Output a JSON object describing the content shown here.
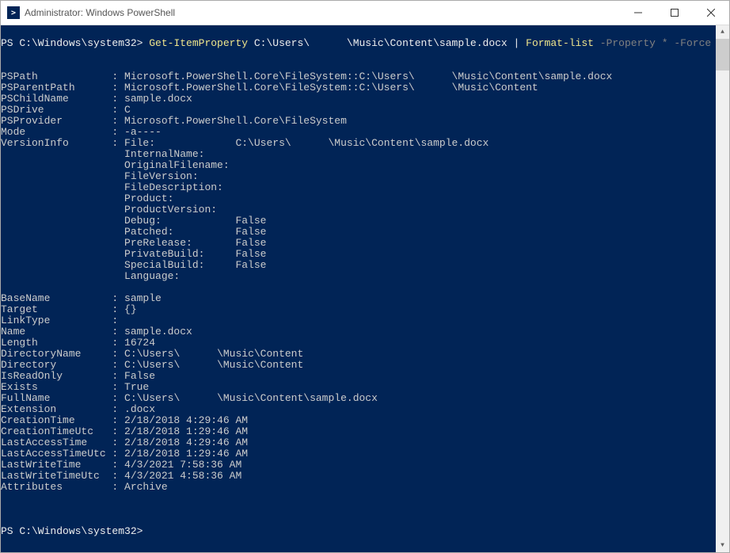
{
  "window": {
    "title": "Administrator: Windows PowerShell"
  },
  "console": {
    "prompt1": "PS C:\\Windows\\system32> ",
    "cmd_part1": "Get-ItemProperty ",
    "cmd_path_a": "C:\\Users\\",
    "cmd_path_redacted": "      ",
    "cmd_path_b": "\\Music\\Content\\sample.docx ",
    "cmd_pipe": "| ",
    "cmd_part2": "Format-list ",
    "cmd_args": "-Property * -Force",
    "blank": "",
    "props": {
      "PSPath_label": "PSPath            : ",
      "PSPath_a": "Microsoft.PowerShell.Core\\FileSystem::C:\\Users\\",
      "PSPath_b": "\\Music\\Content\\sample.docx",
      "PSParentPath_label": "PSParentPath      : ",
      "PSParentPath_a": "Microsoft.PowerShell.Core\\FileSystem::C:\\Users\\",
      "PSParentPath_b": "\\Music\\Content",
      "PSChildName": "PSChildName       : sample.docx",
      "PSDrive": "PSDrive           : C",
      "PSProvider": "PSProvider        : Microsoft.PowerShell.Core\\FileSystem",
      "Mode": "Mode              : -a----",
      "VersionInfo_label": "VersionInfo       : ",
      "Version_File_a": "File:             C:\\Users\\",
      "Version_File_b": "\\Music\\Content\\sample.docx",
      "Version_InternalName": "                    InternalName:     ",
      "Version_OriginalFilename": "                    OriginalFilename: ",
      "Version_FileVersion": "                    FileVersion:      ",
      "Version_FileDescription": "                    FileDescription:  ",
      "Version_Product": "                    Product:          ",
      "Version_ProductVersion": "                    ProductVersion:   ",
      "Version_Debug": "                    Debug:            False",
      "Version_Patched": "                    Patched:          False",
      "Version_PreRelease": "                    PreRelease:       False",
      "Version_PrivateBuild": "                    PrivateBuild:     False",
      "Version_SpecialBuild": "                    SpecialBuild:     False",
      "Version_Language": "                    Language:         ",
      "BaseName": "BaseName          : sample",
      "Target": "Target            : {}",
      "LinkType": "LinkType          : ",
      "Name": "Name              : sample.docx",
      "Length": "Length            : 16724",
      "DirectoryName_label": "DirectoryName     : ",
      "DirectoryName_a": "C:\\Users\\",
      "DirectoryName_b": "\\Music\\Content",
      "Directory_label": "Directory         : ",
      "Directory_a": "C:\\Users\\",
      "Directory_b": "\\Music\\Content",
      "IsReadOnly": "IsReadOnly        : False",
      "Exists": "Exists            : True",
      "FullName_label": "FullName          : ",
      "FullName_a": "C:\\Users\\",
      "FullName_b": "\\Music\\Content\\sample.docx",
      "Extension": "Extension         : .docx",
      "CreationTime": "CreationTime      : 2/18/2018 4:29:46 AM",
      "CreationTimeUtc": "CreationTimeUtc   : 2/18/2018 1:29:46 AM",
      "LastAccessTime": "LastAccessTime    : 2/18/2018 4:29:46 AM",
      "LastAccessTimeUtc": "LastAccessTimeUtc : 2/18/2018 1:29:46 AM",
      "LastWriteTime": "LastWriteTime     : 4/3/2021 7:58:36 AM",
      "LastWriteTimeUtc": "LastWriteTimeUtc  : 4/3/2021 4:58:36 AM",
      "Attributes": "Attributes        : Archive"
    },
    "prompt2": "PS C:\\Windows\\system32>"
  }
}
